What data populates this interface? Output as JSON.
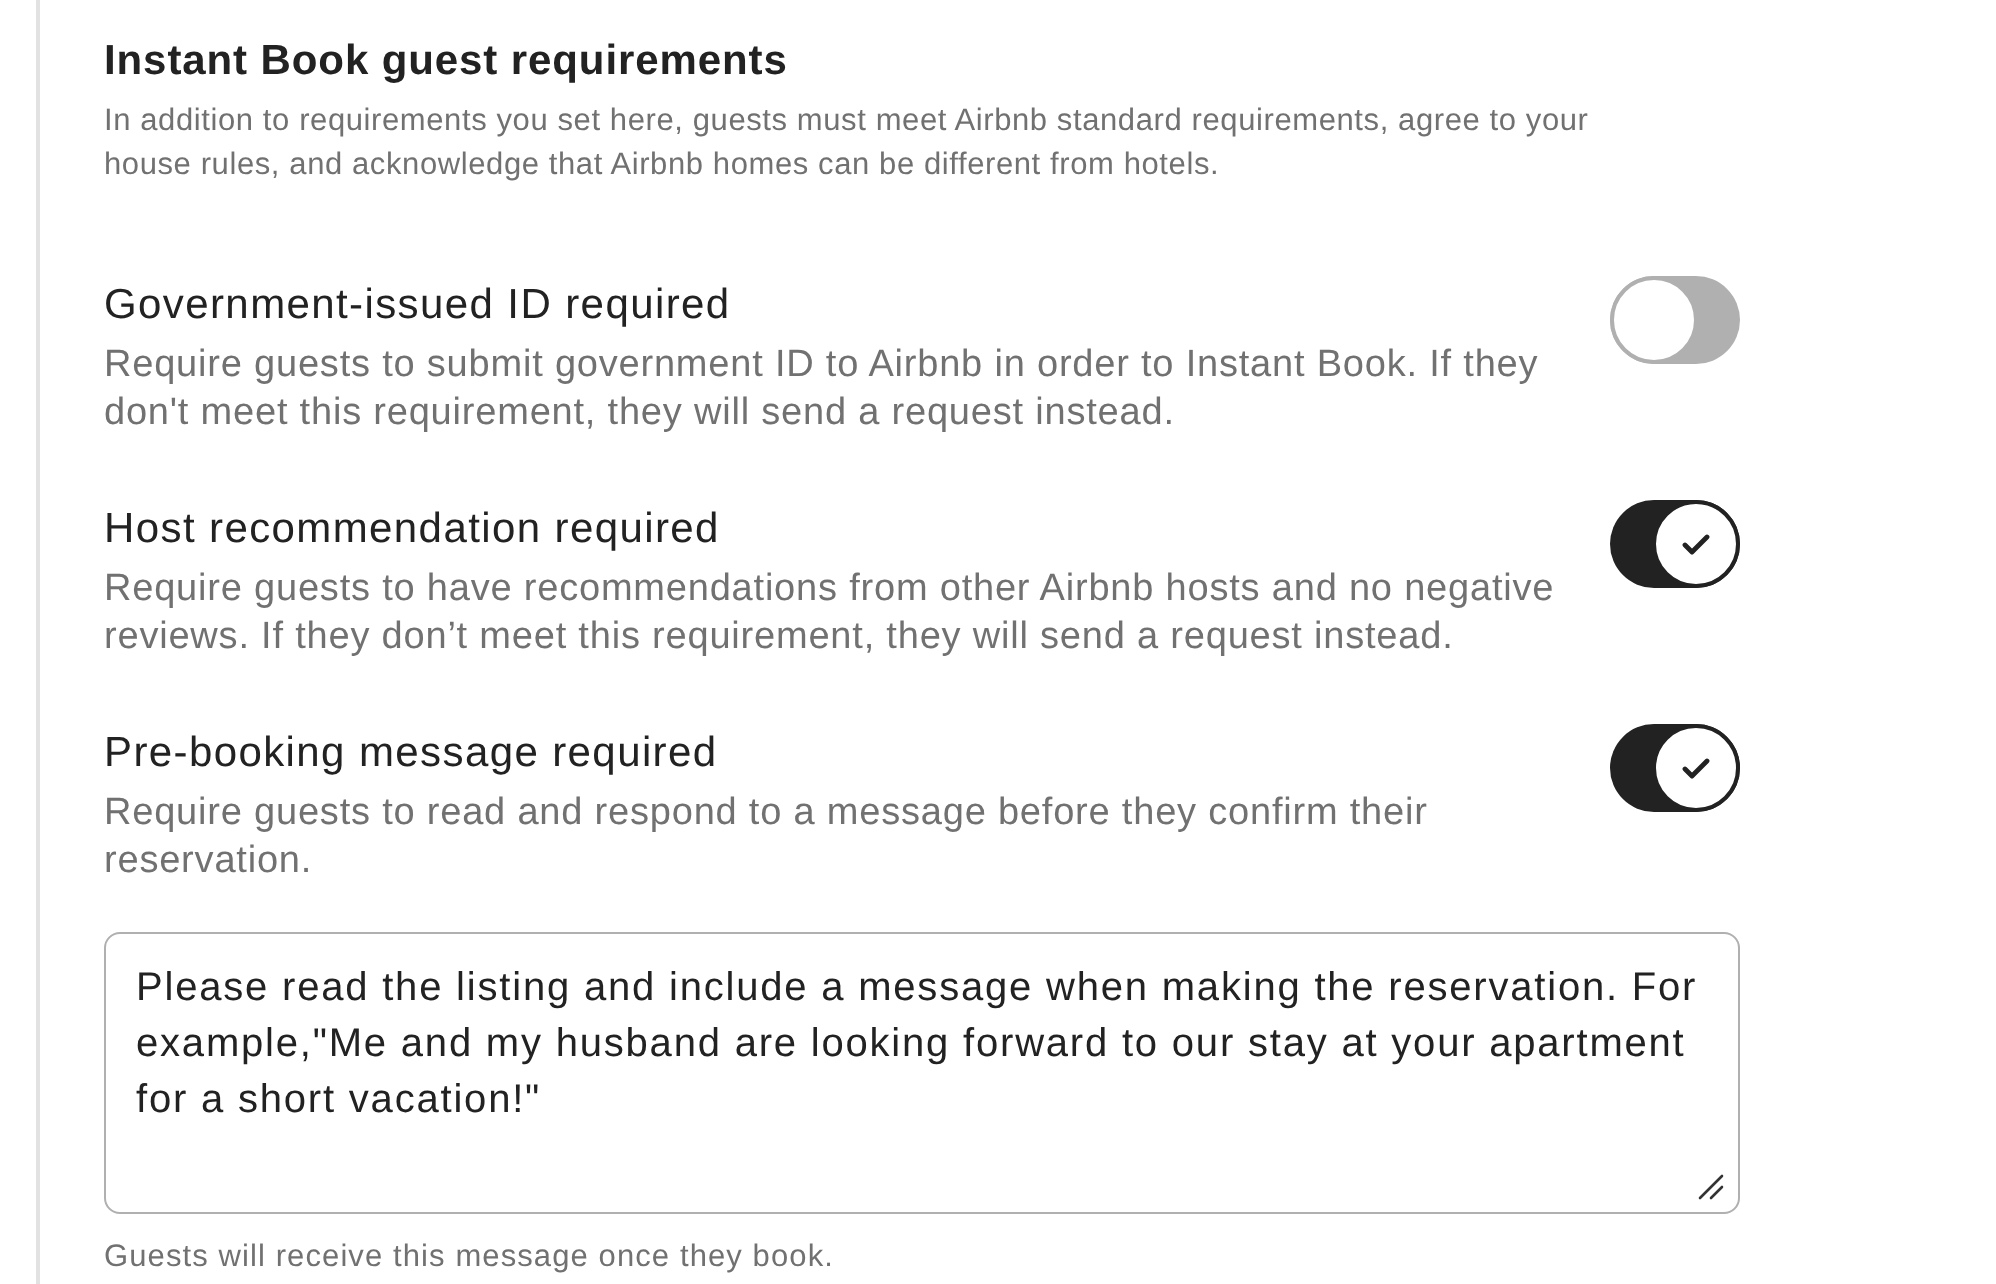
{
  "section": {
    "title": "Instant Book guest requirements",
    "description": "In addition to requirements you set here, guests must meet Airbnb standard requirements, agree to your house rules, and acknowledge that Airbnb homes can be different from hotels."
  },
  "requirements": [
    {
      "label": "Government-issued ID required",
      "description": "Require guests to submit government ID to Airbnb in order to Instant Book. If they don't meet this requirement, they will send a request instead.",
      "on": false
    },
    {
      "label": "Host recommendation required",
      "description": "Require guests to have recommendations from other Airbnb hosts and no negative reviews. If they don’t meet this requirement, they will send a request instead.",
      "on": true
    },
    {
      "label": "Pre-booking message required",
      "description": "Require guests to read and respond to a message before they confirm their reservation.",
      "on": true
    }
  ],
  "message_field": {
    "value": "Please read the listing and include a message when making the reservation. For example,\"Me and my husband are looking forward to our stay at your apartment for a short vacation!\"",
    "helper": "Guests will receive this message once they book."
  }
}
